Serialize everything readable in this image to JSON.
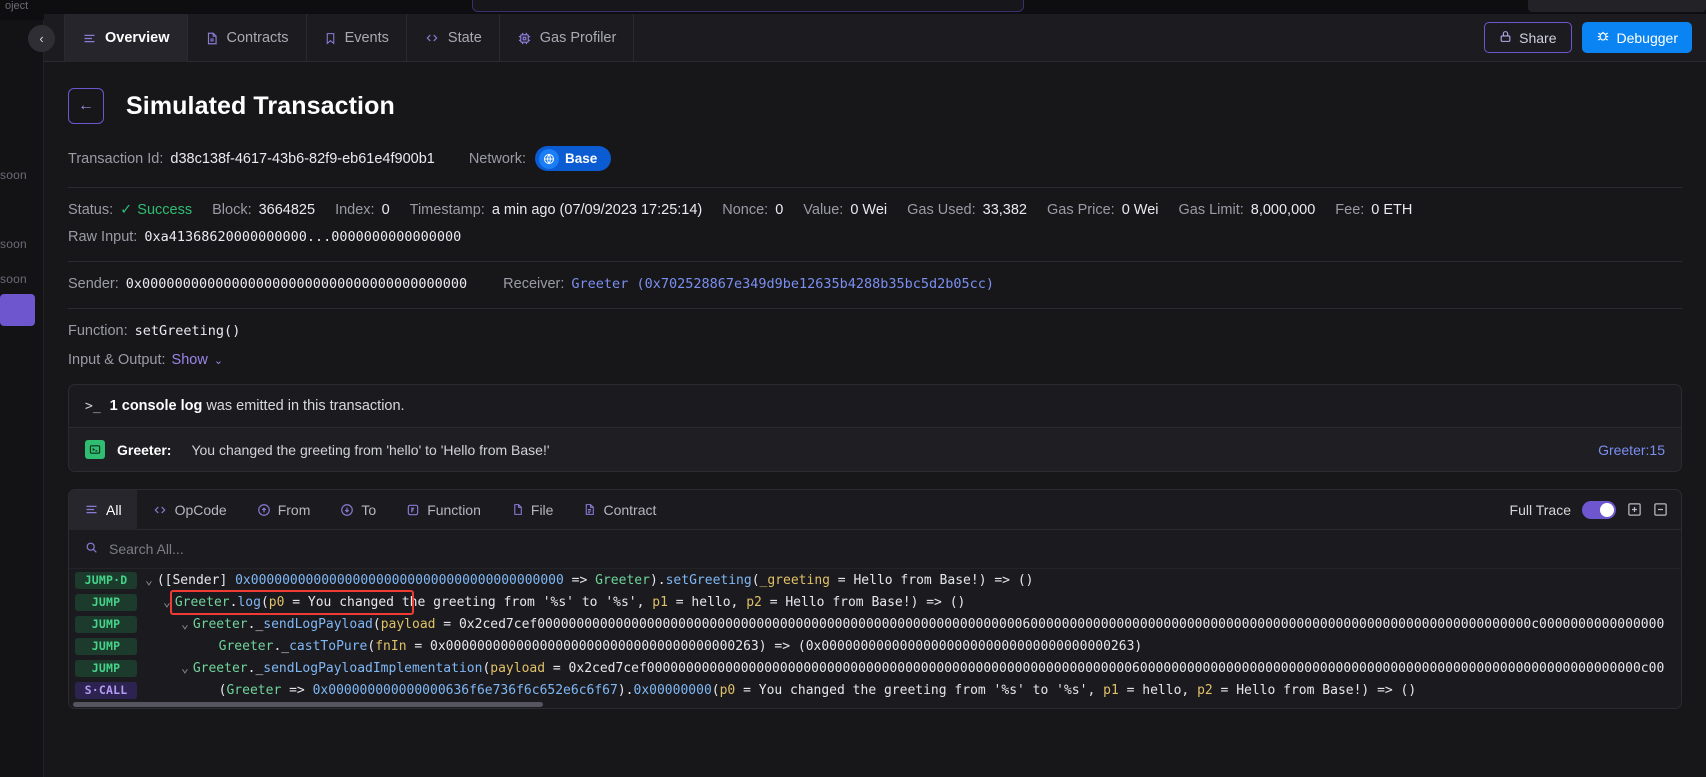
{
  "rail": {
    "top_word": "oject",
    "items": [
      "soon",
      "soon",
      "soon"
    ]
  },
  "tabbar": {
    "collapse_icon": "chevron-left-icon",
    "tabs": [
      {
        "label": "Overview",
        "icon": "list-icon",
        "active": true
      },
      {
        "label": "Contracts",
        "icon": "file-icon",
        "active": false
      },
      {
        "label": "Events",
        "icon": "bookmark-icon",
        "active": false
      },
      {
        "label": "State",
        "icon": "code-icon",
        "active": false
      },
      {
        "label": "Gas Profiler",
        "icon": "chip-icon",
        "active": false
      }
    ],
    "share_label": "Share",
    "share_icon": "lock-icon",
    "debugger_label": "Debugger",
    "debugger_icon": "bug-icon",
    "accent_purple": "#6e56cf",
    "accent_blue": "#0b84f3"
  },
  "page": {
    "back_icon": "arrow-left-icon",
    "title": "Simulated Transaction",
    "transaction_id_label": "Transaction Id:",
    "transaction_id": "d38c138f-4617-43b6-82f9-eb61e4f900b1",
    "network_label": "Network:",
    "network_icon": "globe-icon",
    "network_name": "Base",
    "status_label": "Status:",
    "status_value": "Success",
    "status_icon": "check-icon",
    "status_color": "#2fbd72",
    "block_label": "Block:",
    "block_value": "3664825",
    "index_label": "Index:",
    "index_value": "0",
    "timestamp_label": "Timestamp:",
    "timestamp_value": "a min ago (07/09/2023 17:25:14)",
    "nonce_label": "Nonce:",
    "nonce_value": "0",
    "value_label": "Value:",
    "value_value": "0 Wei",
    "gas_used_label": "Gas Used:",
    "gas_used_value": "33,382",
    "gas_price_label": "Gas Price:",
    "gas_price_value": "0 Wei",
    "gas_limit_label": "Gas Limit:",
    "gas_limit_value": "8,000,000",
    "fee_label": "Fee:",
    "fee_value": "0 ETH",
    "raw_input_label": "Raw Input:",
    "raw_input_value": "0xa41368620000000000...0000000000000000",
    "sender_label": "Sender:",
    "sender_value": "0x0000000000000000000000000000000000000000",
    "receiver_label": "Receiver:",
    "receiver_value": "Greeter (0x702528867e349d9be12635b4288b35bc5d2b05cc)",
    "function_label": "Function:",
    "function_value": "setGreeting()",
    "io_label": "Input & Output:",
    "io_action": "Show",
    "io_caret": "chevron-down-icon"
  },
  "console": {
    "prompt_icon": "terminal-prompt-icon",
    "count_text": "1 console log",
    "tail_text": " was emitted in this transaction.",
    "entry_icon": "console-log-icon",
    "entry_name": "Greeter:",
    "entry_message": "You changed the greeting from 'hello' to 'Hello from Base!'",
    "entry_source": "Greeter:15"
  },
  "trace": {
    "tabs": [
      {
        "label": "All",
        "icon": "list-icon",
        "active": true
      },
      {
        "label": "OpCode",
        "icon": "code-icon",
        "active": false
      },
      {
        "label": "From",
        "icon": "arrow-up-circle-icon",
        "active": false
      },
      {
        "label": "To",
        "icon": "arrow-down-circle-icon",
        "active": false
      },
      {
        "label": "Function",
        "icon": "function-icon",
        "active": false
      },
      {
        "label": "File",
        "icon": "file-outline-icon",
        "active": false
      },
      {
        "label": "Contract",
        "icon": "contract-icon",
        "active": false
      }
    ],
    "full_trace_label": "Full Trace",
    "full_trace_on": true,
    "expand_icon": "expand-all-icon",
    "collapse_icon": "collapse-all-icon",
    "search_icon": "search-icon",
    "search_placeholder": "Search All...",
    "search_value": "",
    "lines": [
      {
        "op": "JUMP·D",
        "op_class": "jumpd",
        "indent": 0,
        "caret": "v",
        "segments": [
          {
            "t": "([Sender] ",
            "c": "c-white"
          },
          {
            "t": "0x0000000000000000000000000000000000000000",
            "c": "c-blue"
          },
          {
            "t": " => ",
            "c": "c-white"
          },
          {
            "t": "Greeter",
            "c": "c-green"
          },
          {
            "t": ").",
            "c": "c-white"
          },
          {
            "t": "setGreeting",
            "c": "c-blue"
          },
          {
            "t": "(",
            "c": "c-white"
          },
          {
            "t": "_greeting",
            "c": "c-gold"
          },
          {
            "t": " = Hello from Base!) => ()",
            "c": "c-white"
          }
        ]
      },
      {
        "op": "JUMP",
        "op_class": "jump",
        "indent": 1,
        "caret": "v",
        "highlight": true,
        "segments": [
          {
            "t": "Greeter",
            "c": "c-green"
          },
          {
            "t": ".",
            "c": "c-white"
          },
          {
            "t": "log",
            "c": "c-blue"
          },
          {
            "t": "(",
            "c": "c-white"
          },
          {
            "t": "p0",
            "c": "c-gold"
          },
          {
            "t": " = You changed the greeting from '%s' to '%s', ",
            "c": "c-white"
          },
          {
            "t": "p1",
            "c": "c-gold"
          },
          {
            "t": " = hello, ",
            "c": "c-white"
          },
          {
            "t": "p2",
            "c": "c-gold"
          },
          {
            "t": " = Hello from Base!) => ()",
            "c": "c-white"
          }
        ]
      },
      {
        "op": "JUMP",
        "op_class": "jump",
        "indent": 2,
        "caret": "v",
        "segments": [
          {
            "t": "Greeter",
            "c": "c-green"
          },
          {
            "t": "._",
            "c": "c-white"
          },
          {
            "t": "sendLogPayload",
            "c": "c-blue"
          },
          {
            "t": "(",
            "c": "c-white"
          },
          {
            "t": "payload",
            "c": "c-gold"
          },
          {
            "t": " = 0x2ced7cef0000000000000000000000000000000000000000000000000000000000000060000000000000000000000000000000000000000000000000000000000000000c0000000000000000",
            "c": "c-white"
          }
        ]
      },
      {
        "op": "JUMP",
        "op_class": "jump",
        "indent": 3,
        "caret": "",
        "segments": [
          {
            "t": "Greeter",
            "c": "c-green"
          },
          {
            "t": "._",
            "c": "c-white"
          },
          {
            "t": "castToPure",
            "c": "c-blue"
          },
          {
            "t": "(",
            "c": "c-white"
          },
          {
            "t": "fnIn",
            "c": "c-gold"
          },
          {
            "t": " = 0x0000000000000000000000000000000000000263) => (0x0000000000000000000000000000000000000263)",
            "c": "c-white"
          }
        ]
      },
      {
        "op": "JUMP",
        "op_class": "jump",
        "indent": 2,
        "caret": "v",
        "segments": [
          {
            "t": "Greeter",
            "c": "c-green"
          },
          {
            "t": "._",
            "c": "c-white"
          },
          {
            "t": "sendLogPayloadImplementation",
            "c": "c-blue"
          },
          {
            "t": "(",
            "c": "c-white"
          },
          {
            "t": "payload",
            "c": "c-gold"
          },
          {
            "t": " = 0x2ced7cef0000000000000000000000000000000000000000000000000000000000000060000000000000000000000000000000000000000000000000000000000000000c00",
            "c": "c-white"
          }
        ]
      },
      {
        "op": "S·CALL",
        "op_class": "scall",
        "indent": 3,
        "caret": "",
        "segments": [
          {
            "t": "(",
            "c": "c-white"
          },
          {
            "t": "Greeter",
            "c": "c-green"
          },
          {
            "t": " => ",
            "c": "c-white"
          },
          {
            "t": "0x000000000000000636f6e736f6c652e6c6f67",
            "c": "c-blue"
          },
          {
            "t": ").",
            "c": "c-white"
          },
          {
            "t": "0x00000000",
            "c": "c-blue"
          },
          {
            "t": "(",
            "c": "c-white"
          },
          {
            "t": "p0",
            "c": "c-gold"
          },
          {
            "t": " = You changed the greeting from '%s' to '%s', ",
            "c": "c-white"
          },
          {
            "t": "p1",
            "c": "c-gold"
          },
          {
            "t": " = hello, ",
            "c": "c-white"
          },
          {
            "t": "p2",
            "c": "c-gold"
          },
          {
            "t": " = Hello from Base!) => ()",
            "c": "c-white"
          }
        ]
      }
    ]
  }
}
